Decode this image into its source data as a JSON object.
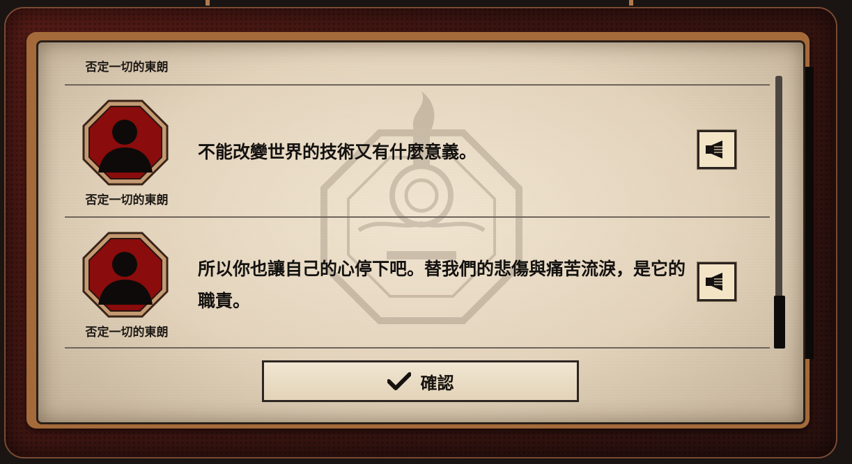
{
  "dialog_log": {
    "entries": [
      {
        "speaker": "否定一切的東朗",
        "text": "",
        "partial": true
      },
      {
        "speaker": "否定一切的東朗",
        "text": "不能改變世界的技術又有什麼意義。"
      },
      {
        "speaker": "否定一切的東朗",
        "text": "所以你也讓自己的心停下吧。替我們的悲傷與痛苦流淚，是它的職責。"
      }
    ],
    "voice_icon": "speaker-icon",
    "confirm_label": "確認",
    "confirm_icon": "checkmark-icon"
  },
  "colors": {
    "frame": "#4a1a15",
    "frame_trim": "#a46a3a",
    "panel": "#e6d8c2",
    "portrait_red": "#8a0c0c",
    "portrait_border": "#c49a72",
    "button_bg": "#f3e4c6"
  }
}
